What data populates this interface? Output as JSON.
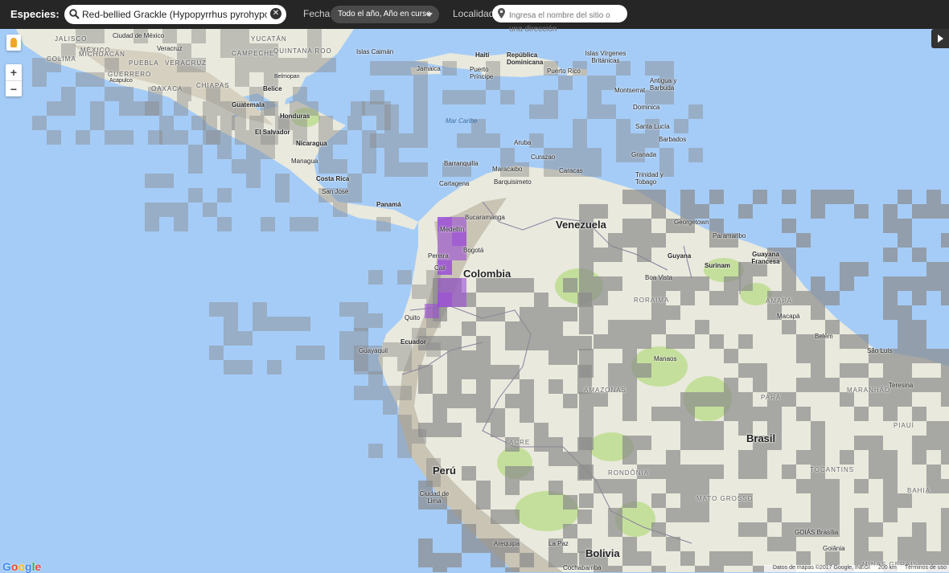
{
  "filters": {
    "species_label": "Especies:",
    "species_value": "Red-bellied Grackle (Hypopyrrhus pyrohypogaste",
    "date_label": "Fecha:",
    "date_value": "Todo el año, Año en curso",
    "location_label": "Localidad:",
    "location_placeholder": "Ingresa el nombre del sitio o una dirección"
  },
  "map": {
    "attribution": "Datos de mapas ©2017 Google, INEGI",
    "scale": "200 km",
    "terms": "Términos de uso",
    "logo": "Google",
    "zoom_in": "+",
    "zoom_out": "−",
    "colors": {
      "ocean": "#a5ccf7",
      "land": "#e9e9dd",
      "mountains": "#c9c4b4",
      "forest": "#c4df9b",
      "grid_no_sightings": "#8a8a8a",
      "sightings": "#9b4dd6"
    },
    "labels": {
      "mexico": "MÉXICO",
      "jalisco": "JALISCO",
      "ciudad_mexico": "Ciudad de México",
      "colima": "COLIMA",
      "michoacan": "MICHOACÁN",
      "puebla": "PUEBLA",
      "veracruz_state": "VERACRUZ",
      "veracruz": "Veracruz",
      "guerrero": "GUERRERO",
      "acapulco": "Acapulco",
      "oaxaca": "OAXACA",
      "chiapas": "CHIAPAS",
      "yucatan": "YUCATÁN",
      "campeche": "CAMPECHE",
      "quintana_roo": "QUINTANA ROO",
      "belmopan": "Belmopan",
      "belice": "Belice",
      "guatemala": "Guatemala",
      "honduras": "Honduras",
      "el_salvador": "El Salvador",
      "nicaragua": "Nicaragua",
      "managua": "Managua",
      "costa_rica": "Costa Rica",
      "san_jose": "San José",
      "panama": "Panamá",
      "islas_caiman": "Islas Caimán",
      "jamaica": "Jamaica",
      "haiti": "Haití",
      "republica_dominicana": "República Dominicana",
      "puerto_principe": "Puerto Príncipe",
      "puerto_rico": "Puerto Rico",
      "islas_virgenes": "Islas Vírgenes Británicas",
      "antigua": "Antigua y Barbuda",
      "montserrat": "Montserrat",
      "dominica": "Dominica",
      "santa_lucia": "Santa Lucía",
      "barbados": "Barbados",
      "granada": "Granada",
      "trinidad": "Trinidad y Tobago",
      "mar_caribe": "Mar Caribe",
      "aruba": "Aruba",
      "curazao": "Curazao",
      "barranquilla": "Barranquilla",
      "maracaibo": "Maracaibo",
      "caracas": "Caracas",
      "cartagena": "Cartagena",
      "barquisimeto": "Barquisimeto",
      "bucaramanga": "Bucaramanga",
      "venezuela": "Venezuela",
      "georgetown": "Georgetown",
      "paramaribo": "Paramaribo",
      "medellin": "Medellín",
      "pereira": "Pereira",
      "bogota": "Bogotá",
      "cali": "Cali",
      "colombia": "Colombia",
      "guyana": "Guyana",
      "surinam": "Surinam",
      "guayana_francesa": "Guayana Francesa",
      "boa_vista": "Boa Vista",
      "roraima": "RORAIMA",
      "amapa": "AMAPÁ",
      "macapa": "Macapá",
      "quito": "Quito",
      "ecuador": "Ecuador",
      "guayaquil": "Guayaquil",
      "belem": "Belém",
      "sao_luis": "São Luís",
      "manaos": "Manaos",
      "amazonas": "AMAZONAS",
      "para": "PARÁ",
      "maranhao": "MARANHÃO",
      "teresina": "Teresina",
      "piaui": "PIAUÍ",
      "acre": "ACRE",
      "brasil": "Brasil",
      "rondonia": "RONDÔNIA",
      "tocantins": "TOCANTINS",
      "bahia": "BAHIA",
      "peru": "Perú",
      "lima": "Ciudad de Lima",
      "mato_grosso": "MATO GROSSO",
      "goias_brasilia": "GOIÁS Brasília",
      "goiania": "Goiânia",
      "minas_gerais": "MINAS GERAIS",
      "arequipa": "Arequipa",
      "la_paz": "La Paz",
      "bolivia": "Bolivia",
      "cochabamba": "Cochabamba"
    }
  }
}
